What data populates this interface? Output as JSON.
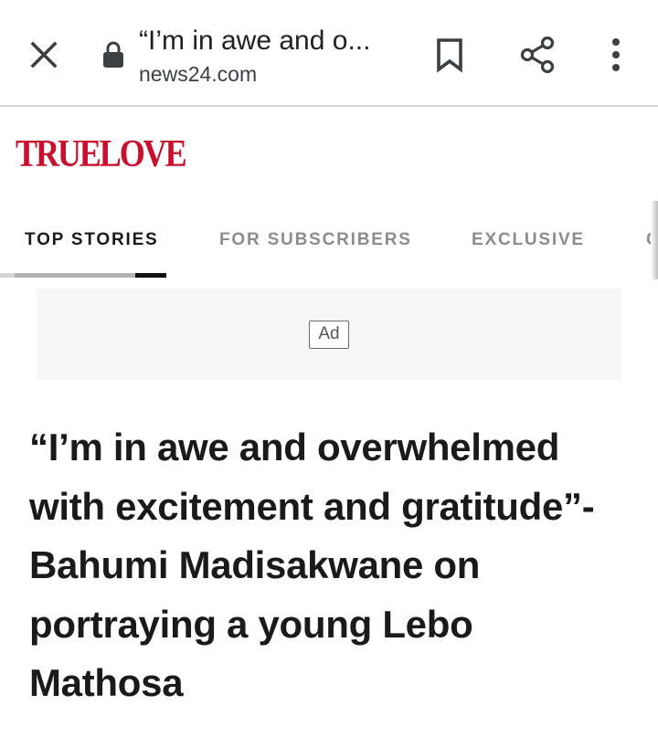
{
  "browser": {
    "page_title": "“I’m in awe and o...",
    "domain": "news24.com",
    "icons": {
      "close": "close-icon",
      "lock": "lock-icon",
      "bookmark": "bookmark-icon",
      "share": "share-icon",
      "menu": "more-vert-icon"
    }
  },
  "site": {
    "logo_text": "TRUELOVE",
    "brand_color": "#c8102e"
  },
  "tabs": [
    {
      "label": "TOP STORIES",
      "active": true
    },
    {
      "label": "FOR SUBSCRIBERS",
      "active": false
    },
    {
      "label": "EXCLUSIVE",
      "active": false
    },
    {
      "label": "C",
      "active": false
    }
  ],
  "ad": {
    "label": "Ad"
  },
  "article": {
    "headline": "“I’m in awe and overwhelmed with excitement and gratitude”- Bahumi Madisakwane on portraying a young Lebo Mathosa"
  }
}
